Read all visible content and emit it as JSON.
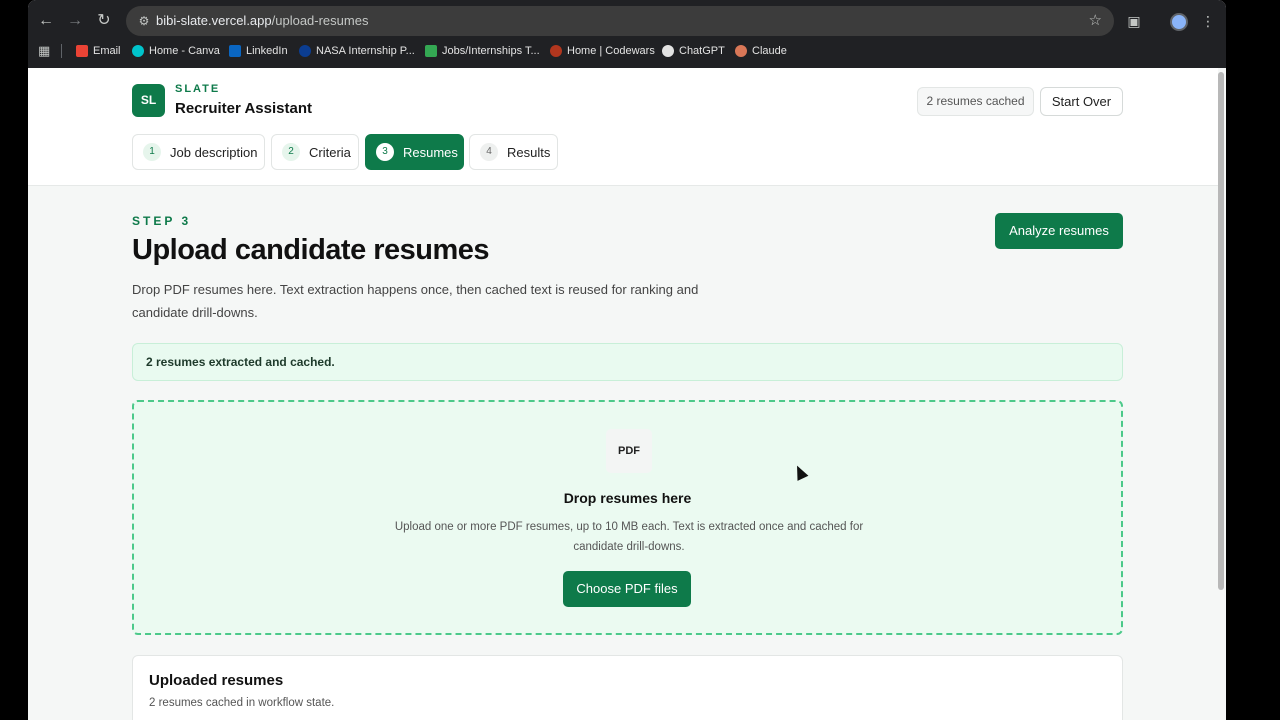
{
  "browser": {
    "url_host": "bibi-slate.vercel.app",
    "url_path": "/upload-resumes",
    "bookmarks": [
      {
        "label": "Email",
        "color": "#ea4335"
      },
      {
        "label": "Home - Canva",
        "color": "#00c4cc"
      },
      {
        "label": "LinkedIn",
        "color": "#0a66c2"
      },
      {
        "label": "NASA Internship P...",
        "color": "#0b3d91"
      },
      {
        "label": "Jobs/Internships T...",
        "color": "#34a853"
      },
      {
        "label": "Home | Codewars",
        "color": "#b1361e"
      },
      {
        "label": "ChatGPT",
        "color": "#e3e3e3"
      },
      {
        "label": "Claude",
        "color": "#d97757"
      }
    ]
  },
  "header": {
    "logo": "SL",
    "brand_small": "SLATE",
    "brand_title": "Recruiter Assistant",
    "cached_badge": "2 resumes cached",
    "start_over": "Start Over"
  },
  "steps": [
    {
      "num": "1",
      "label": "Job description",
      "state": "done"
    },
    {
      "num": "2",
      "label": "Criteria",
      "state": "done"
    },
    {
      "num": "3",
      "label": "Resumes",
      "state": "active"
    },
    {
      "num": "4",
      "label": "Results",
      "state": "future"
    }
  ],
  "main": {
    "step_label": "STEP 3",
    "title": "Upload candidate resumes",
    "description": "Drop PDF resumes here. Text extraction happens once, then cached text is reused for ranking and candidate drill-downs.",
    "analyze_button": "Analyze resumes",
    "success_message": "2 resumes extracted and cached."
  },
  "dropzone": {
    "badge": "PDF",
    "title": "Drop resumes here",
    "help": "Upload one or more PDF resumes, up to 10 MB each. Text is extracted once and cached for candidate drill-downs.",
    "button": "Choose PDF files"
  },
  "uploaded": {
    "title": "Uploaded resumes",
    "subtitle": "2 resumes cached in workflow state."
  },
  "colors": {
    "brand": "#0e7a4a",
    "success_bg": "#e9faf0",
    "dropzone_border": "#4cc98a"
  }
}
